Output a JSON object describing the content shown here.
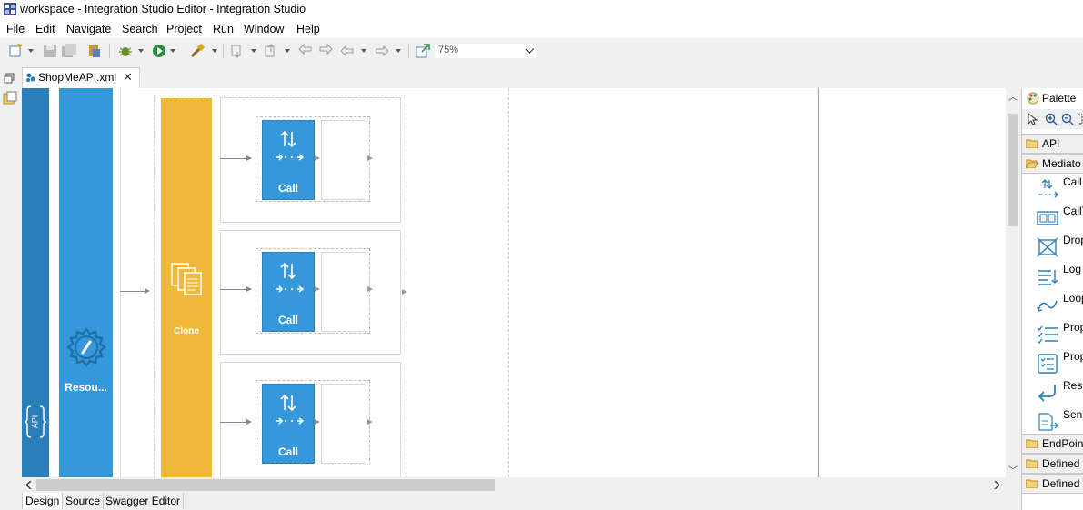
{
  "window": {
    "title": "workspace - Integration Studio Editor - Integration Studio"
  },
  "menu": [
    "File",
    "Edit",
    "Navigate",
    "Search",
    "Project",
    "Run",
    "Window",
    "Help"
  ],
  "toolbar": {
    "zoom_value": "75%"
  },
  "editor": {
    "tab_label": "ShopMeAPI.xml"
  },
  "diagram": {
    "resource_label": "Resou...",
    "clone_label": "Clone",
    "branches": [
      {
        "mediator_label": "Call"
      },
      {
        "mediator_label": "Call"
      },
      {
        "mediator_label": "Call"
      }
    ]
  },
  "bottom_tabs": [
    "Design",
    "Source",
    "Swagger Editor"
  ],
  "palette": {
    "title": "Palette",
    "drawers": {
      "api": "API",
      "mediators": "Mediato",
      "endpoints": "EndPoin",
      "defined1": "Defined",
      "defined2": "Defined"
    },
    "entries": [
      {
        "label": "Call",
        "icon": "call-icon"
      },
      {
        "label": "CallT",
        "icon": "call-template-icon"
      },
      {
        "label": "Drop",
        "icon": "drop-icon"
      },
      {
        "label": "Log",
        "icon": "log-icon"
      },
      {
        "label": "Loop",
        "icon": "loopback-icon"
      },
      {
        "label": "Prop",
        "icon": "property-icon"
      },
      {
        "label": "Prop",
        "icon": "property-group-icon"
      },
      {
        "label": "Resp",
        "icon": "respond-icon"
      },
      {
        "label": "Send",
        "icon": "send-icon"
      }
    ]
  },
  "colors": {
    "api_band": "#2a7fba",
    "resource_band": "#3598db",
    "clone": "#f0b93c",
    "call": "#3598db"
  }
}
